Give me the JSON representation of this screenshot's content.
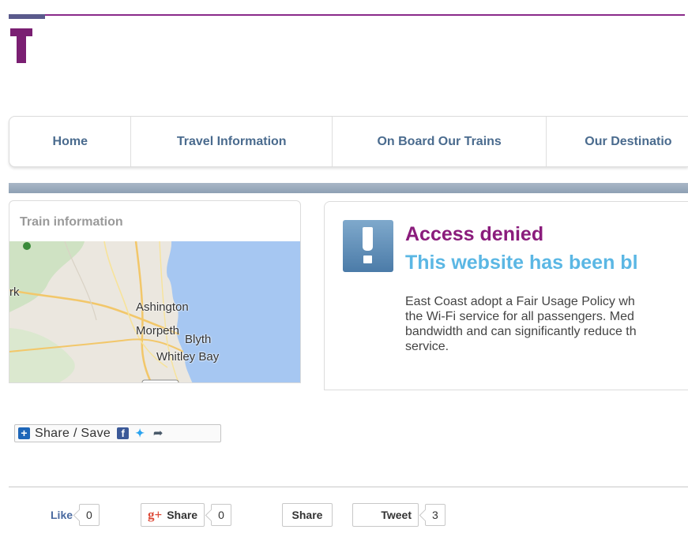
{
  "header": {
    "logo_letter": "T",
    "brand_color": "#7a1f72"
  },
  "nav": {
    "items": [
      {
        "label": "Home"
      },
      {
        "label": "Travel Information"
      },
      {
        "label": "On Board Our Trains"
      },
      {
        "label": "Our Destinatio"
      }
    ]
  },
  "left_panel": {
    "title": "Train information",
    "map_labels": [
      "Ashington",
      "Morpeth",
      "Blyth",
      "Whitley Bay",
      "rk"
    ]
  },
  "right_panel": {
    "icon": "exclamation-icon",
    "heading": "Access denied",
    "subheading": "This website has been bl",
    "body_lines": [
      "East Coast adopt a Fair Usage Policy wh",
      "the Wi-Fi service for all passengers. Med",
      "bandwidth and can significantly reduce th",
      "service."
    ],
    "colors": {
      "heading": "#8a1c7c",
      "subheading": "#5bb7e4"
    }
  },
  "share_save": {
    "label": "Share / Save",
    "icons": [
      "plus-icon",
      "facebook-icon",
      "twitter-icon",
      "share-arrow-icon"
    ]
  },
  "social": {
    "like": {
      "label": "Like",
      "count": "0"
    },
    "gplus": {
      "glyph": "g+",
      "label": "Share",
      "count": "0"
    },
    "share": {
      "label": "Share"
    },
    "tweet": {
      "label": "Tweet",
      "count": "3"
    }
  }
}
